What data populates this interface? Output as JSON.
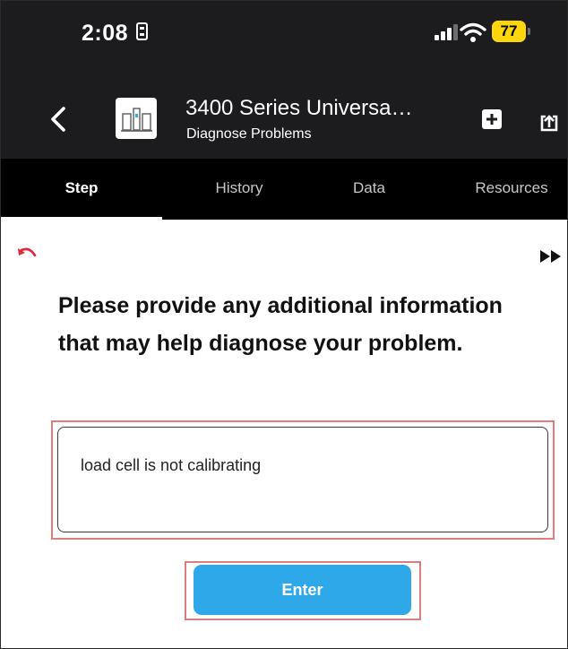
{
  "status_bar": {
    "time": "2:08",
    "battery": "77"
  },
  "header": {
    "title": "3400 Series Universa…",
    "subtitle": "Diagnose Problems"
  },
  "tabs": [
    {
      "label": "Step",
      "active": true
    },
    {
      "label": "History",
      "active": false
    },
    {
      "label": "Data",
      "active": false
    },
    {
      "label": "Resources",
      "active": false
    }
  ],
  "main": {
    "question": "Please provide any additional information that may help diagnose your problem.",
    "input_value": "load cell is not calibrating",
    "enter_label": "Enter"
  },
  "colors": {
    "bar_background": "#1c1c1e",
    "tab_background": "#000000",
    "accent_red": "#e0263a",
    "button_blue": "#2fa8ea",
    "highlight_outline": "#e07b7f",
    "battery_yellow": "#ffd60a"
  },
  "icons": [
    "sim-icon",
    "signal-icon",
    "wifi-icon",
    "battery-icon",
    "back-chevron-icon",
    "machine-thumbnail-icon",
    "add-note-icon",
    "share-icon",
    "undo-icon",
    "fast-forward-icon"
  ]
}
